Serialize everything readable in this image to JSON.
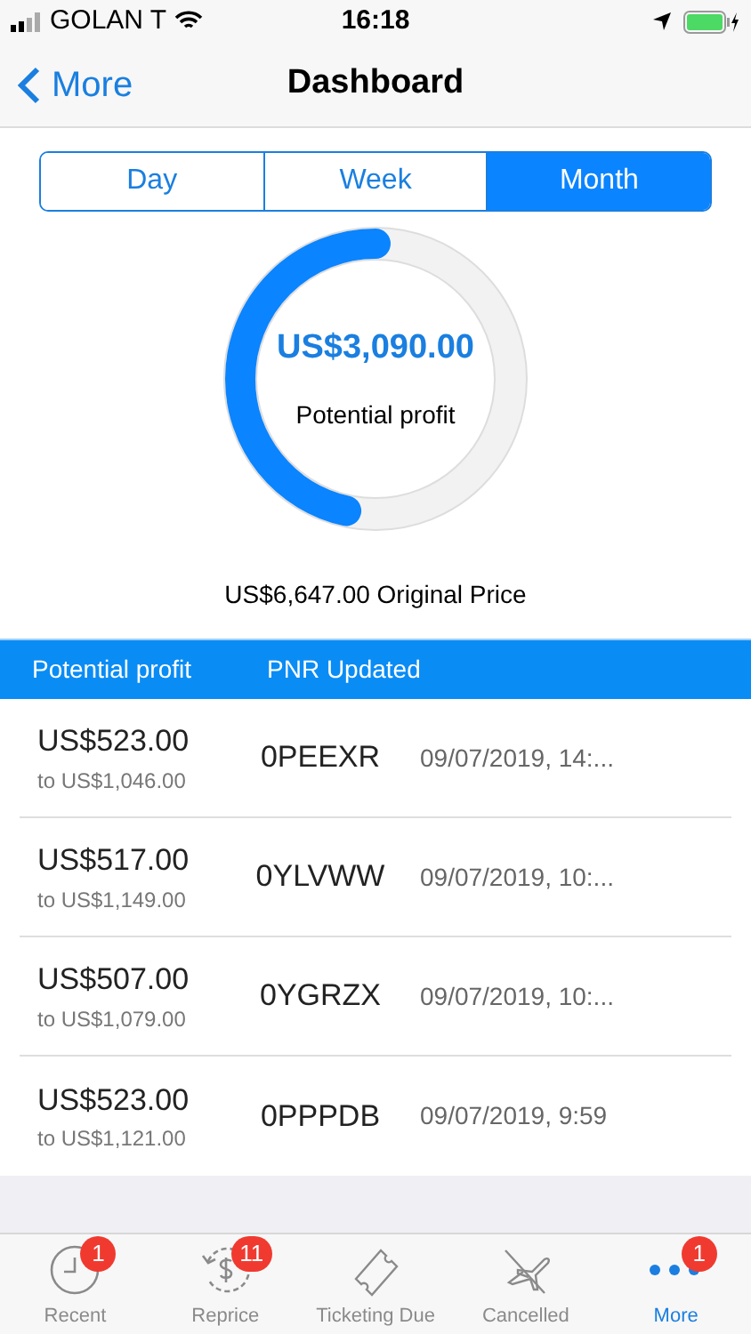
{
  "status_bar": {
    "carrier": "GOLAN T",
    "time": "16:18"
  },
  "nav": {
    "back": "More",
    "title": "Dashboard"
  },
  "segments": [
    {
      "label": "Day",
      "selected": false
    },
    {
      "label": "Week",
      "selected": false
    },
    {
      "label": "Month",
      "selected": true
    }
  ],
  "gauge": {
    "level": 0.465,
    "amount": "US$3,090.00",
    "caption": "Potential profit"
  },
  "original_price": "US$6,647.00 Original Price",
  "table": {
    "columns": [
      "Potential profit",
      "PNR Updated"
    ],
    "rows": [
      {
        "profit": "US$523.00",
        "range": "to US$1,046.00",
        "pnr": "0PEEXR",
        "updated": "09/07/2019, 14:..."
      },
      {
        "profit": "US$517.00",
        "range": "to US$1,149.00",
        "pnr": "0YLVWW",
        "updated": "09/07/2019, 10:..."
      },
      {
        "profit": "US$507.00",
        "range": "to US$1,079.00",
        "pnr": "0YGRZX",
        "updated": "09/07/2019, 10:..."
      },
      {
        "profit": "US$523.00",
        "range": "to US$1,121.00",
        "pnr": "0PPPDB",
        "updated": "09/07/2019, 9:59"
      }
    ]
  },
  "tab_bar": [
    {
      "kind": "clock",
      "label": "Recent",
      "badge": "1",
      "selected": false
    },
    {
      "kind": "reprice",
      "label": "Reprice",
      "badge": "11",
      "selected": false
    },
    {
      "kind": "ticket",
      "label": "Ticketing Due",
      "selected": false
    },
    {
      "kind": "plane",
      "label": "Cancelled",
      "selected": false
    },
    {
      "kind": "more",
      "label": "More",
      "badge": "1",
      "selected": true
    }
  ]
}
